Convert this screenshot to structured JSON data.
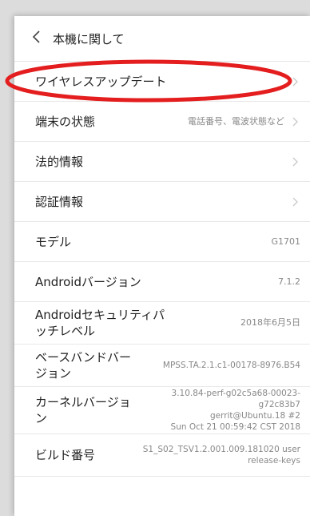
{
  "header": {
    "title": "本機に関して",
    "back_icon": "chevron-left-icon"
  },
  "rows": [
    {
      "label": "ワイヤレスアップデート",
      "value": "",
      "chevron": true
    },
    {
      "label": "端末の状態",
      "value": "電話番号、電波状態など",
      "chevron": true
    },
    {
      "label": "法的情報",
      "value": "",
      "chevron": true
    },
    {
      "label": "認証情報",
      "value": "",
      "chevron": true
    },
    {
      "label": "モデル",
      "value": "G1701",
      "chevron": false
    },
    {
      "label": "Androidバージョン",
      "value": "7.1.2",
      "chevron": false
    },
    {
      "label": "Androidセキュリティパッチレベル",
      "value": "2018年6月5日",
      "chevron": false
    },
    {
      "label": "ベースバンドバージョン",
      "value": "MPSS.TA.2.1.c1-00178-8976.B54",
      "chevron": false
    },
    {
      "label": "カーネルバージョン",
      "value_lines": [
        "3.10.84-perf-g02c5a68-00023-",
        "g72c83b7",
        "gerrit@Ubuntu.18 #2",
        "Sun Oct 21 00:59:42 CST 2018"
      ],
      "chevron": false
    },
    {
      "label": "ビルド番号",
      "value_lines": [
        "S1_S02_TSV1.2.001.009.181020 user",
        "release-keys"
      ],
      "chevron": false
    }
  ],
  "annotation": {
    "color": "#e41e1e",
    "target": "ワイヤレスアップデート"
  },
  "colors": {
    "background": "#dcdcdc",
    "surface": "#ffffff",
    "text": "#222222",
    "secondary": "#888888",
    "divider": "#e8e8e8"
  }
}
